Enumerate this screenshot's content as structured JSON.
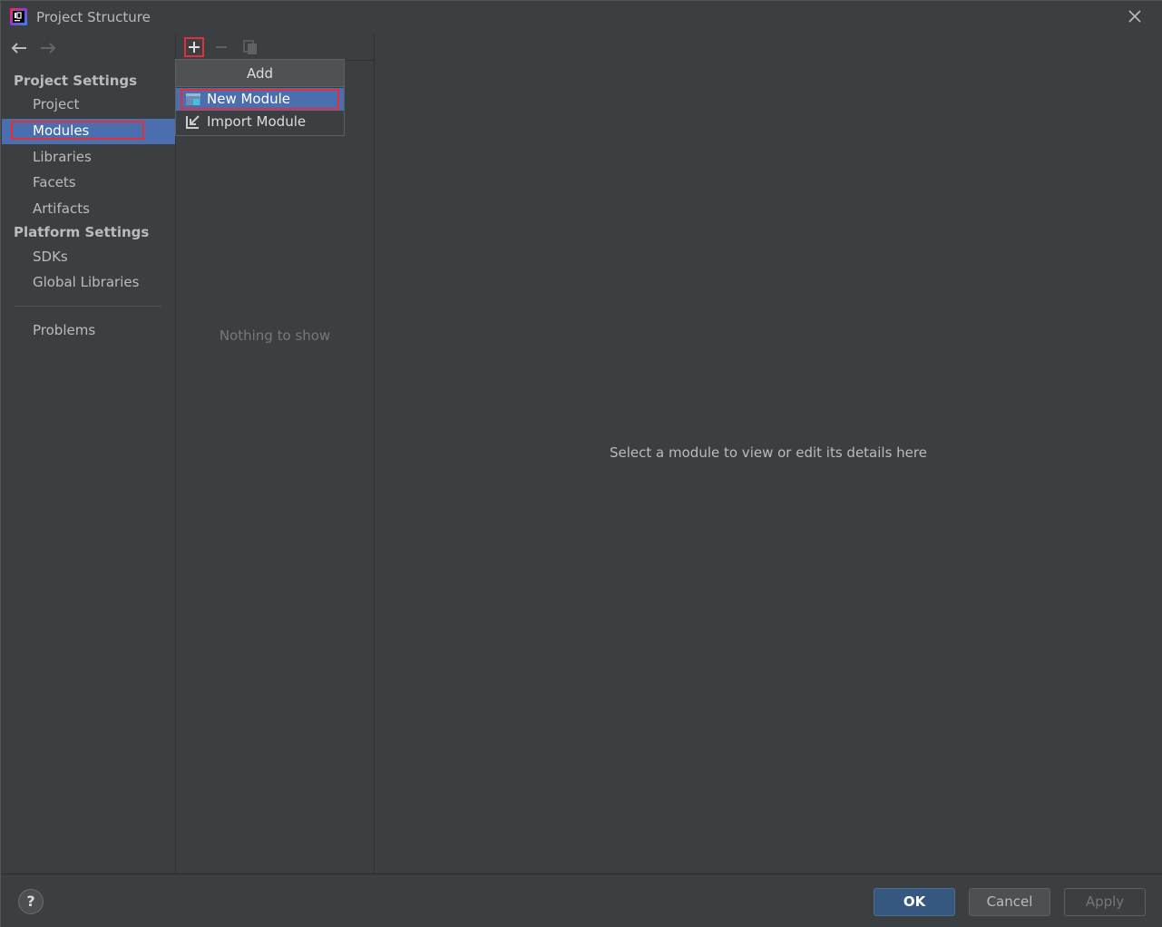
{
  "window": {
    "title": "Project Structure"
  },
  "sidebar": {
    "project_settings_heading": "Project Settings",
    "project_items": [
      "Project",
      "Modules",
      "Libraries",
      "Facets",
      "Artifacts"
    ],
    "selected": "Modules",
    "platform_settings_heading": "Platform Settings",
    "platform_items": [
      "SDKs",
      "Global Libraries"
    ],
    "problems": "Problems"
  },
  "middle": {
    "empty_text": "Nothing to show",
    "toolbar_icons": [
      "add-icon",
      "remove-icon",
      "copy-icon"
    ]
  },
  "popup": {
    "title": "Add",
    "items": [
      "New Module",
      "Import Module"
    ]
  },
  "detail": {
    "placeholder": "Select a module to view or edit its details here"
  },
  "footer": {
    "help": "?",
    "ok": "OK",
    "cancel": "Cancel",
    "apply": "Apply"
  },
  "colors": {
    "accent": "#4b6eaf",
    "highlight": "#e0303a",
    "background": "#3c3f41"
  }
}
